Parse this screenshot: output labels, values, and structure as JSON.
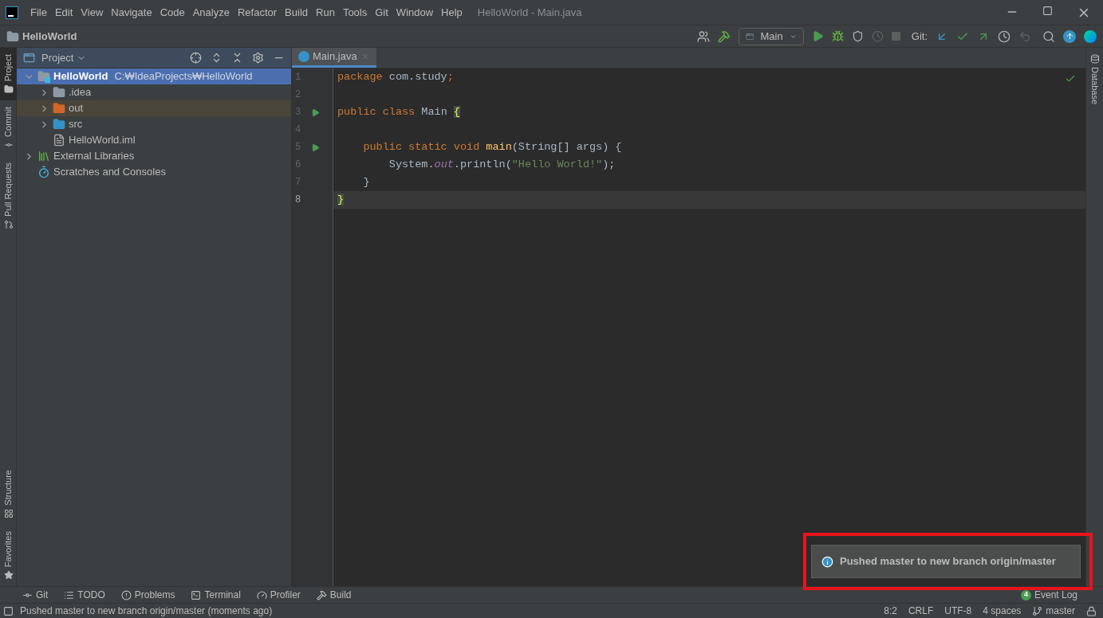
{
  "window": {
    "title": "HelloWorld - Main.java"
  },
  "menu": [
    "File",
    "Edit",
    "View",
    "Navigate",
    "Code",
    "Analyze",
    "Refactor",
    "Build",
    "Run",
    "Tools",
    "Git",
    "Window",
    "Help"
  ],
  "nav_bar": {
    "project": "HelloWorld"
  },
  "toolbar": {
    "run_config": "Main",
    "git_label": "Git:"
  },
  "left_strip": {
    "top": [
      {
        "label": "Project",
        "selected": true
      },
      {
        "label": "Commit",
        "selected": false
      },
      {
        "label": "Pull Requests",
        "selected": false
      }
    ],
    "bottom": [
      {
        "label": "Structure",
        "selected": false
      },
      {
        "label": "Favorites",
        "selected": false
      }
    ]
  },
  "right_strip": [
    {
      "label": "Database",
      "selected": false
    }
  ],
  "project_panel": {
    "title": "Project",
    "tree": [
      {
        "label": "HelloWorld",
        "path": "C:₩IdeaProjects₩HelloWorld",
        "kind": "module",
        "selected": true,
        "expanded": true,
        "children": [
          {
            "label": ".idea",
            "kind": "folder",
            "selected": false,
            "expanded": false
          },
          {
            "label": "out",
            "kind": "excluded_folder",
            "selected": false,
            "expanded": false
          },
          {
            "label": "src",
            "kind": "source_folder",
            "selected": false,
            "expanded": false
          },
          {
            "label": "HelloWorld.iml",
            "kind": "file",
            "selected": false
          }
        ]
      },
      {
        "label": "External Libraries",
        "kind": "libraries",
        "selected": false,
        "expanded": false
      },
      {
        "label": "Scratches and Consoles",
        "kind": "scratches",
        "selected": false
      }
    ]
  },
  "editor": {
    "tabs": [
      {
        "label": "Main.java",
        "selected": true
      }
    ],
    "lines": [
      {
        "number": "1",
        "run": false,
        "current": false,
        "tokens": [
          {
            "text": "package ",
            "kind": "keyword"
          },
          {
            "text": "com.study",
            "kind": "plain"
          },
          {
            "text": ";",
            "kind": "keyword"
          }
        ]
      },
      {
        "number": "2",
        "run": false,
        "current": false
      },
      {
        "number": "3",
        "run": true,
        "current": false,
        "tokens": [
          {
            "text": "public class ",
            "kind": "keyword"
          },
          {
            "text": "Main ",
            "kind": "plain"
          },
          {
            "text": "{",
            "kind": "brace"
          }
        ]
      },
      {
        "number": "4",
        "run": false,
        "current": false
      },
      {
        "number": "5",
        "run": true,
        "current": false,
        "tokens": [
          {
            "text": "    public static void ",
            "kind": "keyword"
          },
          {
            "text": "main",
            "kind": "method"
          },
          {
            "text": "(String[] args) {",
            "kind": "plain"
          }
        ]
      },
      {
        "number": "6",
        "run": false,
        "current": false,
        "tokens": [
          {
            "text": "        System.",
            "kind": "plain"
          },
          {
            "text": "out",
            "kind": "static"
          },
          {
            "text": ".println(",
            "kind": "plain"
          },
          {
            "text": "\"Hello World!\"",
            "kind": "string"
          },
          {
            "text": ");",
            "kind": "plain"
          }
        ]
      },
      {
        "number": "7",
        "run": false,
        "current": false,
        "tokens": [
          {
            "text": "    }",
            "kind": "plain"
          }
        ]
      },
      {
        "number": "8",
        "run": false,
        "current": true,
        "tokens": [
          {
            "text": "}",
            "kind": "brace"
          }
        ]
      }
    ]
  },
  "notification": {
    "text": "Pushed master to new branch origin/master",
    "highlighted": true
  },
  "tool_windows": [
    "Git",
    "TODO",
    "Problems",
    "Terminal",
    "Profiler",
    "Build"
  ],
  "event_log": {
    "count": "4",
    "label": "Event Log"
  },
  "status_bar": {
    "message": "Pushed master to new branch origin/master (moments ago)",
    "items": [
      "8:2",
      "CRLF",
      "UTF-8",
      "4 spaces"
    ],
    "branch": "master"
  }
}
